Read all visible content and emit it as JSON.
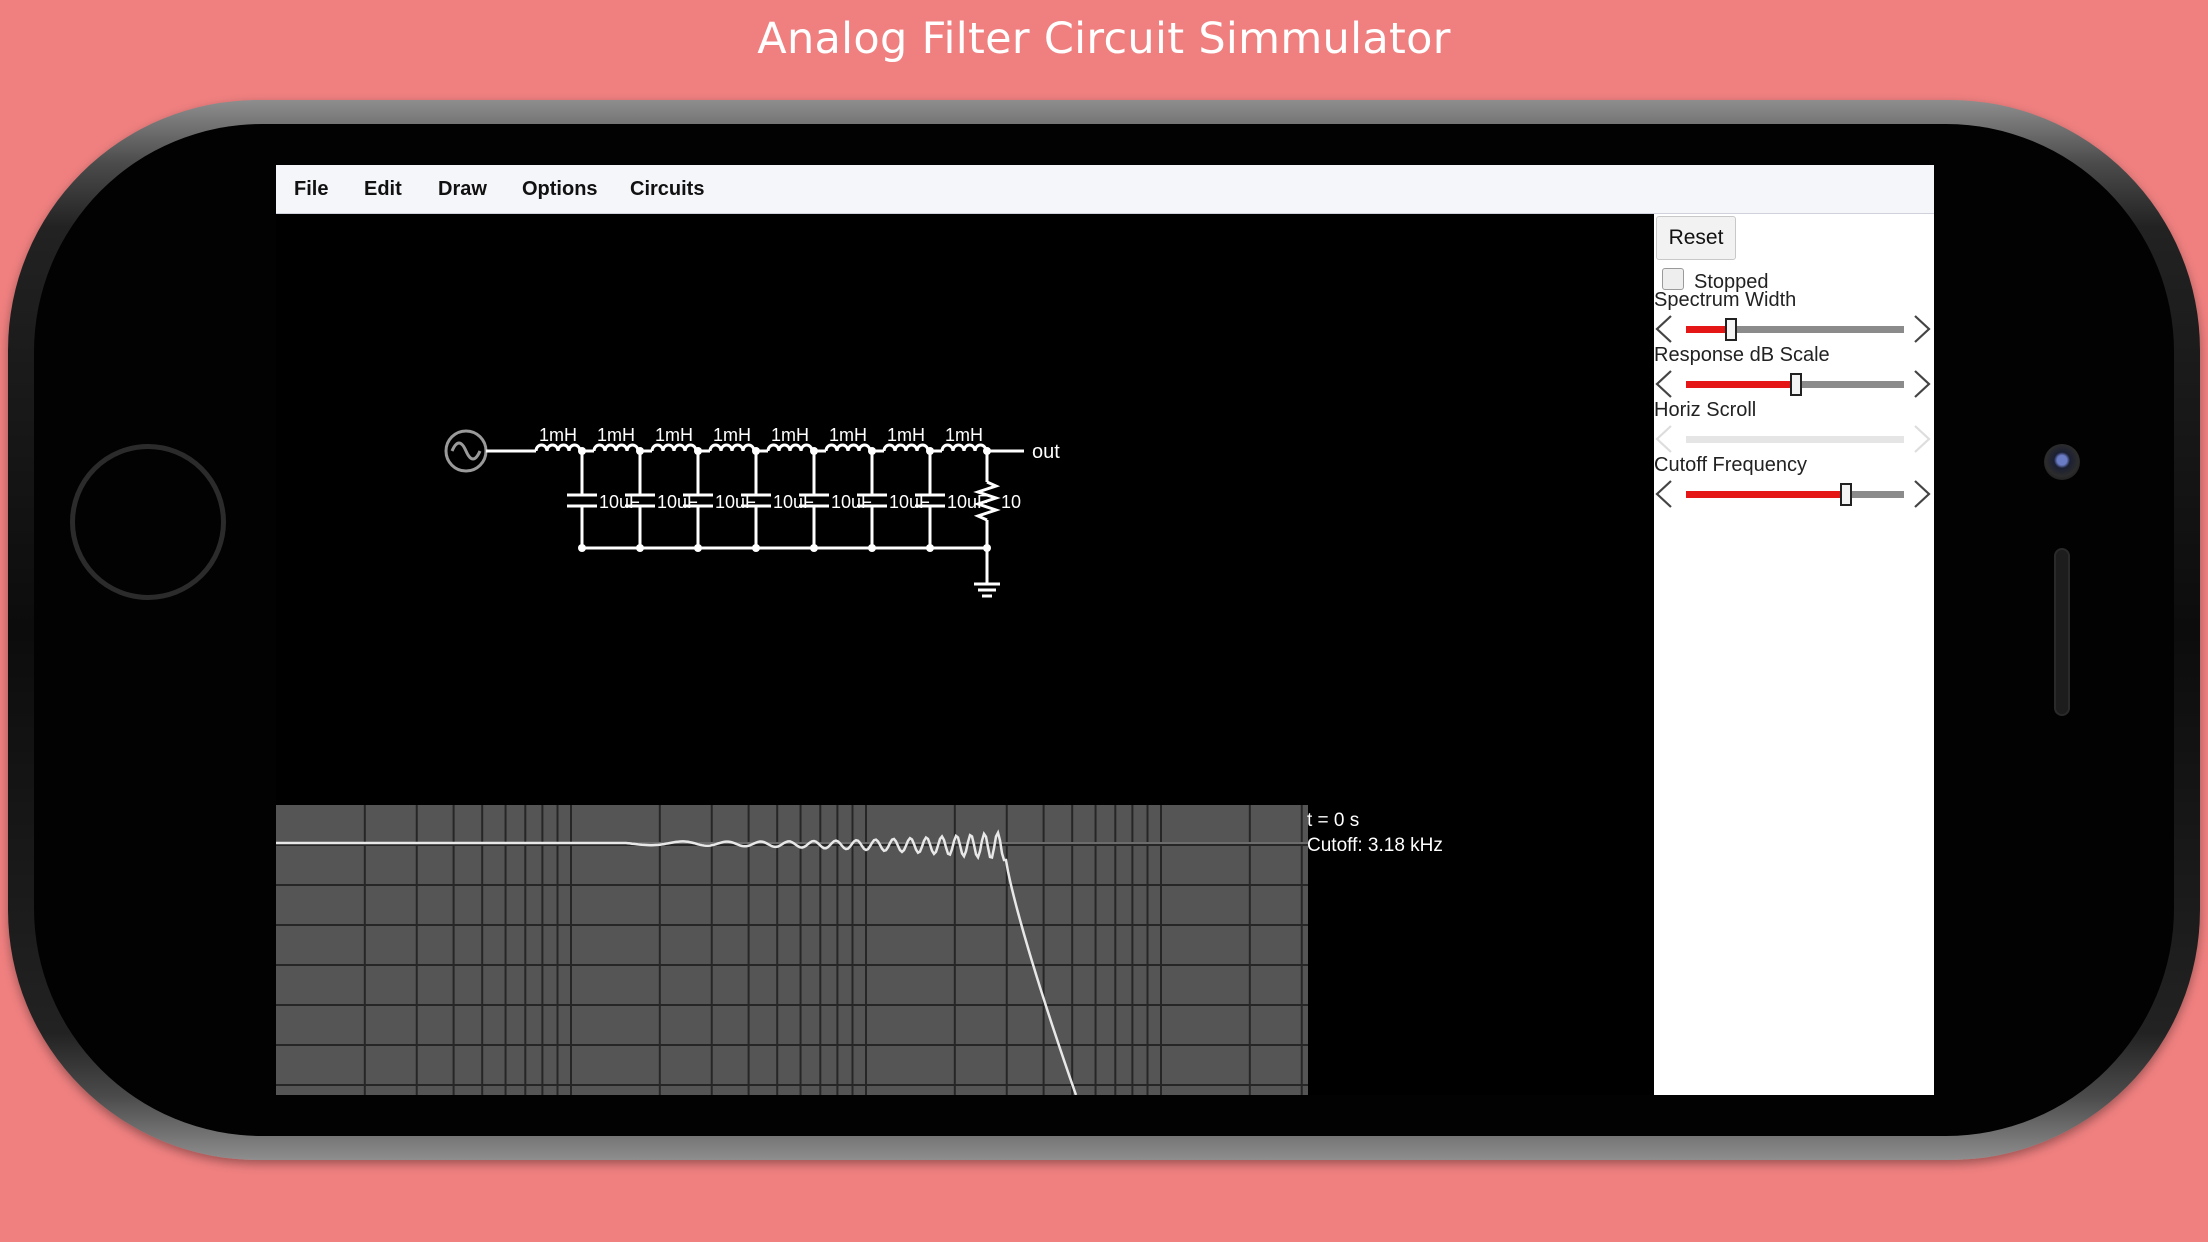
{
  "banner": {
    "title": "Analog Filter Circuit Simmulator"
  },
  "menu": {
    "items": [
      "File",
      "Edit",
      "Draw",
      "Options",
      "Circuits"
    ]
  },
  "sidebar": {
    "reset_label": "Reset",
    "stopped": {
      "label": "Stopped",
      "checked": false
    },
    "sliders": [
      {
        "label": "Spectrum Width",
        "value": 0.2,
        "enabled": true
      },
      {
        "label": "Response dB Scale",
        "value": 0.5,
        "enabled": true
      },
      {
        "label": "Horiz Scroll",
        "value": 0,
        "enabled": false
      },
      {
        "label": "Cutoff Frequency",
        "value": 0.73,
        "enabled": true
      }
    ]
  },
  "circuit": {
    "inductor_label": "1mH",
    "inductor_count": 8,
    "capacitor_label": "10uF",
    "capacitor_count": 7,
    "resistor_label": "10",
    "output_label": "out"
  },
  "readout": {
    "time": "t = 0 s",
    "cutoff": "Cutoff: 3.18 kHz"
  },
  "colors": {
    "background": "#F08080",
    "slider_fill": "#E51616",
    "graph_bg": "#555555",
    "grid": "#2a2a2a"
  }
}
